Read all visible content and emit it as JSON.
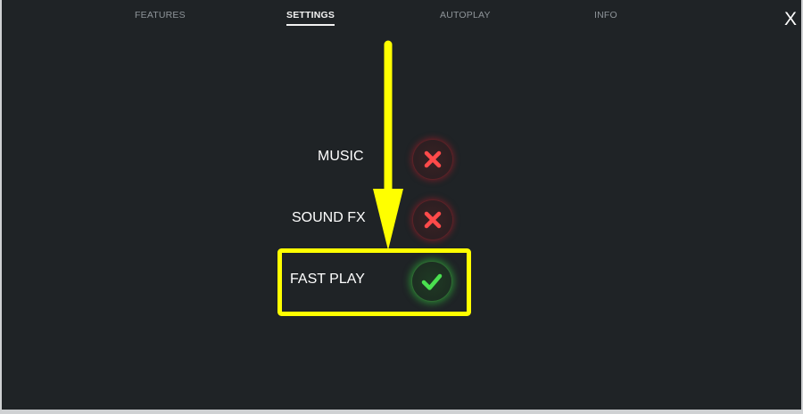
{
  "tabs": [
    {
      "label": "FEATURES",
      "active": false
    },
    {
      "label": "SETTINGS",
      "active": true
    },
    {
      "label": "AUTOPLAY",
      "active": false
    },
    {
      "label": "INFO",
      "active": false
    }
  ],
  "close_label": "X",
  "settings": [
    {
      "label": "MUSIC",
      "enabled": false,
      "icon": "x-icon"
    },
    {
      "label": "SOUND FX",
      "enabled": false,
      "icon": "x-icon"
    },
    {
      "label": "FAST PLAY",
      "enabled": true,
      "icon": "checkmark-icon"
    }
  ],
  "colors": {
    "background": "#1f2326",
    "tab_inactive": "#8e9499",
    "tab_active": "#f2f2f2",
    "off_accent": "#ff4a4a",
    "on_accent": "#4ae04f",
    "annotation": "#ffff00"
  },
  "annotation": {
    "arrow_icon": "down-arrow",
    "highlight_target": "FAST PLAY"
  }
}
